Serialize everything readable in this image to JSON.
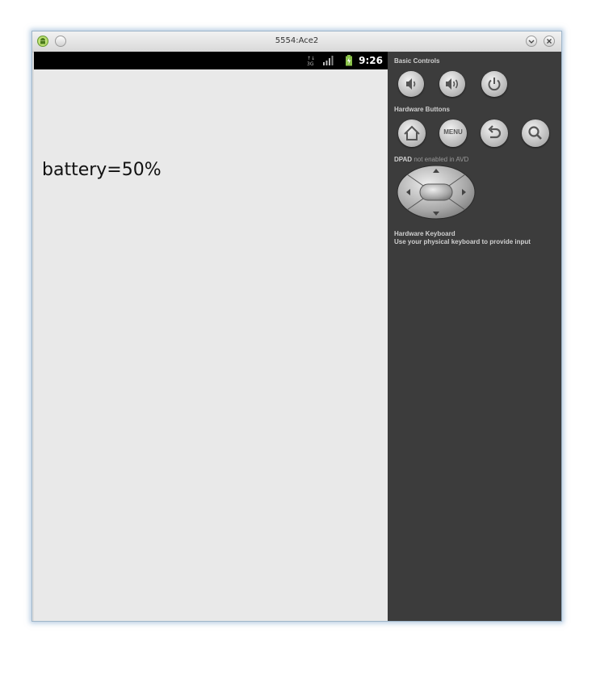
{
  "window": {
    "title": "5554:Ace2",
    "app_icon": "android-icon",
    "minimize_icon": "minimize-icon",
    "close_icon": "close-icon"
  },
  "status_bar": {
    "time": "9:26",
    "icons": [
      "data-3g-icon",
      "signal-icon",
      "battery-charging-icon"
    ]
  },
  "screen": {
    "text": "battery=50%"
  },
  "controls": {
    "basic_label": "Basic Controls",
    "basic_buttons": [
      "volume-down-icon",
      "volume-up-icon",
      "power-icon"
    ],
    "hardware_label": "Hardware Buttons",
    "hardware_buttons": [
      "home-icon",
      "menu",
      "back-icon",
      "search-icon"
    ],
    "menu_label": "MENU",
    "dpad_label": "DPAD",
    "dpad_note": "not enabled in AVD",
    "keyboard_label": "Hardware Keyboard",
    "keyboard_note": "Use your physical keyboard to provide input"
  },
  "colors": {
    "panel_bg": "#3c3c3c",
    "screen_bg": "#e9e9e9",
    "status_bar_bg": "#000000",
    "battery_green": "#8bc34a"
  }
}
